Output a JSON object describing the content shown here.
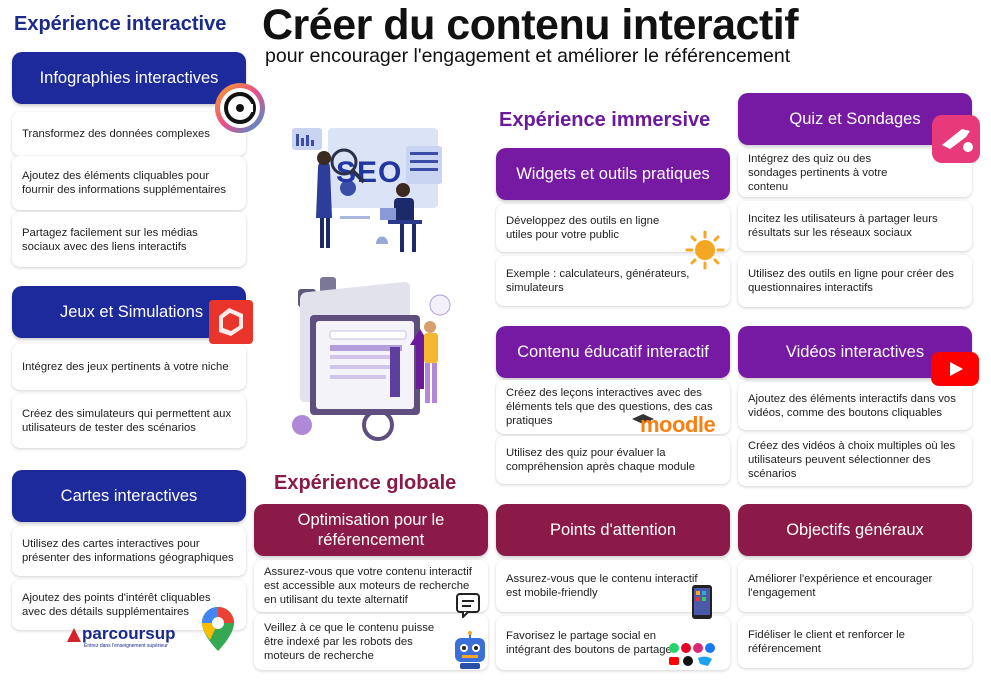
{
  "header": {
    "title": "Créer du contenu interactif",
    "subtitle": "pour encourager l'engagement et améliorer le référencement"
  },
  "sections": {
    "interactive": "Expérience interactive",
    "immersive": "Expérience immersive",
    "global": "Expérience globale"
  },
  "cards": {
    "infographies": {
      "title": "Infographies interactives",
      "items": [
        "Transformez des données complexes",
        "Ajoutez des éléments cliquables pour fournir des informations supplémentaires",
        "Partagez facilement sur les médias sociaux avec des liens interactifs"
      ]
    },
    "jeux": {
      "title": "Jeux et Simulations",
      "items": [
        "Intégrez des jeux pertinents à votre niche",
        "Créez des simulateurs qui permettent aux utilisateurs de tester des scénarios"
      ]
    },
    "cartes": {
      "title": "Cartes interactives",
      "items": [
        "Utilisez des cartes interactives pour présenter des informations géographiques",
        "Ajoutez des points d'intérêt cliquables avec des détails supplémentaires"
      ]
    },
    "widgets": {
      "title": "Widgets et outils pratiques",
      "items": [
        "Développez des outils en ligne utiles pour votre public",
        "Exemple : calculateurs, générateurs, simulateurs"
      ]
    },
    "quiz": {
      "title": "Quiz et Sondages",
      "items": [
        "Intégrez des quiz ou des sondages pertinents à votre contenu",
        "Incitez les utilisateurs à partager leurs résultats sur les réseaux sociaux",
        "Utilisez des outils en ligne pour créer des questionnaires interactifs"
      ]
    },
    "educatif": {
      "title": "Contenu éducatif interactif",
      "items": [
        "Créez des leçons interactives avec des éléments tels que des questions, des cas pratiques",
        "Utilisez des quiz pour évaluer la compréhension après chaque module"
      ]
    },
    "videos": {
      "title": "Vidéos interactives",
      "items": [
        "Ajoutez des éléments interactifs dans vos vidéos, comme des boutons cliquables",
        "Créez des vidéos à choix multiples où les utilisateurs peuvent sélectionner des scénarios"
      ]
    },
    "optimisation": {
      "title": "Optimisation pour le référencement",
      "items": [
        "Assurez-vous que votre contenu interactif est accessible aux moteurs de recherche en utilisant du texte alternatif",
        "Veillez à ce que le contenu puisse être indexé par les robots des moteurs de recherche"
      ]
    },
    "points": {
      "title": "Points d'attention",
      "items": [
        "Assurez-vous que le contenu interactif est mobile-friendly",
        "Favorisez le partage social en intégrant des boutons de partage"
      ]
    },
    "objectifs": {
      "title": "Objectifs généraux",
      "items": [
        "Améliorer l'expérience et encourager l'engagement",
        "Fidéliser le client et renforcer le référencement"
      ]
    }
  },
  "logos": {
    "parcoursup": "parcoursup",
    "parcoursup_tagline": "Entrez dans l'enseignement supérieur",
    "moodle": "moodle",
    "seo": "SEO"
  },
  "colors": {
    "blue": "#1c2a9c",
    "purple": "#761aa3",
    "maroon": "#8c1a48"
  }
}
